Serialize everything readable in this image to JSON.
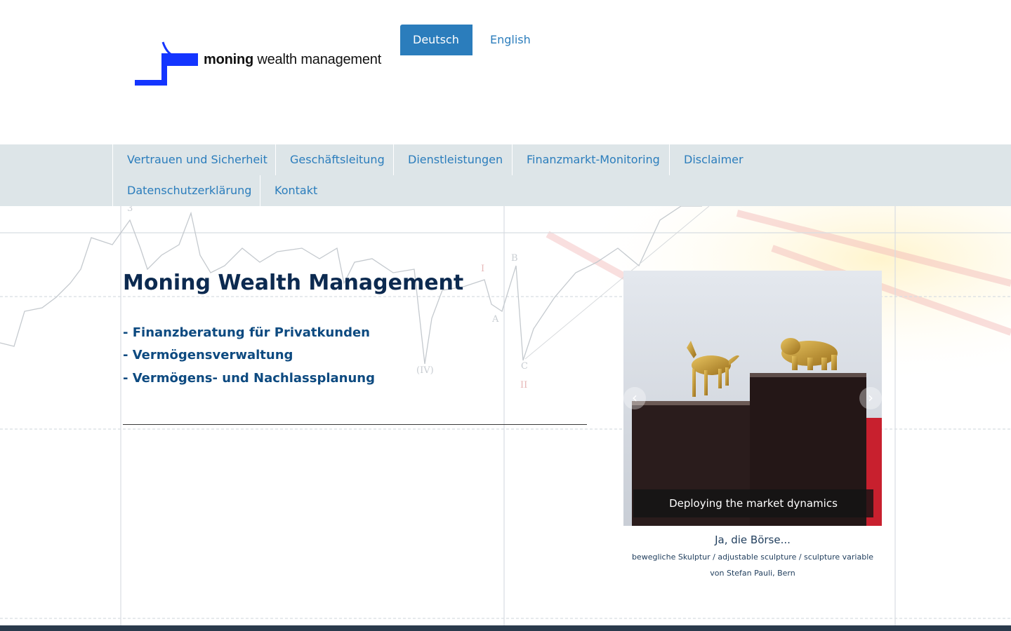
{
  "header": {
    "logo_text_bold": "moning",
    "logo_text_rest": " wealth management",
    "languages": [
      {
        "label": "Deutsch",
        "active": true
      },
      {
        "label": "English",
        "active": false
      }
    ]
  },
  "nav": {
    "items": [
      {
        "label": "Vertrauen und Sicherheit"
      },
      {
        "label": "Geschäftsleitung"
      },
      {
        "label": "Dienstleistungen"
      },
      {
        "label": "Finanzmarkt-Monitoring"
      },
      {
        "label": "Disclaimer"
      },
      {
        "label": "Datenschutzerklärung"
      },
      {
        "label": "Kontakt"
      }
    ]
  },
  "main": {
    "title": "Moning Wealth Management",
    "services": [
      "- Finanzberatung für Privatkunden",
      "- Vermögensverwaltung",
      "- Vermögens- und Nachlassplanung"
    ]
  },
  "slider": {
    "caption": "Deploying the market dynamics",
    "prev_icon": "chevron-left-icon",
    "next_icon": "chevron-right-icon",
    "title": "Ja, die Börse...",
    "subtitle_line1": "bewegliche Skulptur / adjustable sculpture / sculpture variable",
    "subtitle_line2": "von Stefan Pauli, Bern"
  },
  "background": {
    "wave_labels": [
      "3",
      "I",
      "B",
      "A",
      "(IV)",
      "C",
      "II"
    ]
  },
  "colors": {
    "accent": "#2b7dbc",
    "nav_bg": "#dde5e8",
    "title": "#0c2a50",
    "services": "#0d4a80",
    "footer": "#2a3a4c"
  }
}
